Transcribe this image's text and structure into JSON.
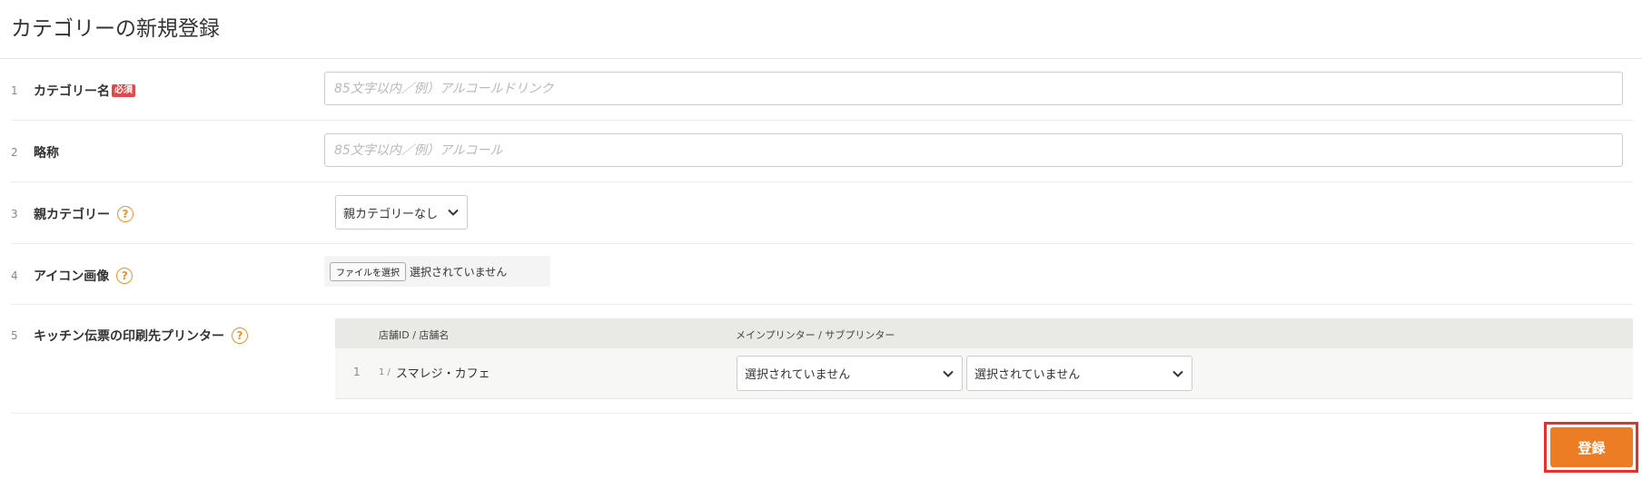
{
  "page": {
    "title": "カテゴリーの新規登録"
  },
  "form": {
    "rows": [
      {
        "num": "1",
        "label": "カテゴリー名",
        "required_badge": "必須",
        "placeholder": "85文字以内／例）アルコールドリンク"
      },
      {
        "num": "2",
        "label": "略称",
        "placeholder": "85文字以内／例）アルコール"
      },
      {
        "num": "3",
        "label": "親カテゴリー",
        "help": "?",
        "select_value": "親カテゴリーなし"
      },
      {
        "num": "4",
        "label": "アイコン画像",
        "help": "?",
        "file_button": "ファイルを選択",
        "file_status": "選択されていません"
      },
      {
        "num": "5",
        "label": "キッチン伝票の印刷先プリンター",
        "help": "?"
      }
    ]
  },
  "printer_table": {
    "headers": {
      "store": "店舗ID / 店舗名",
      "printer": "メインプリンター / サブプリンター"
    },
    "rows": [
      {
        "num": "1",
        "store_id": "1 /",
        "store_name": "スマレジ・カフェ",
        "main_printer": "選択されていません",
        "sub_printer": "選択されていません"
      }
    ]
  },
  "submit": {
    "label": "登録"
  },
  "colors": {
    "accent": "#ec7d25",
    "required": "#e04a4a",
    "help": "#f0912a",
    "highlight": "#e8302a"
  },
  "icons": {
    "select": "chevron-down-icon",
    "help": "help-icon"
  }
}
